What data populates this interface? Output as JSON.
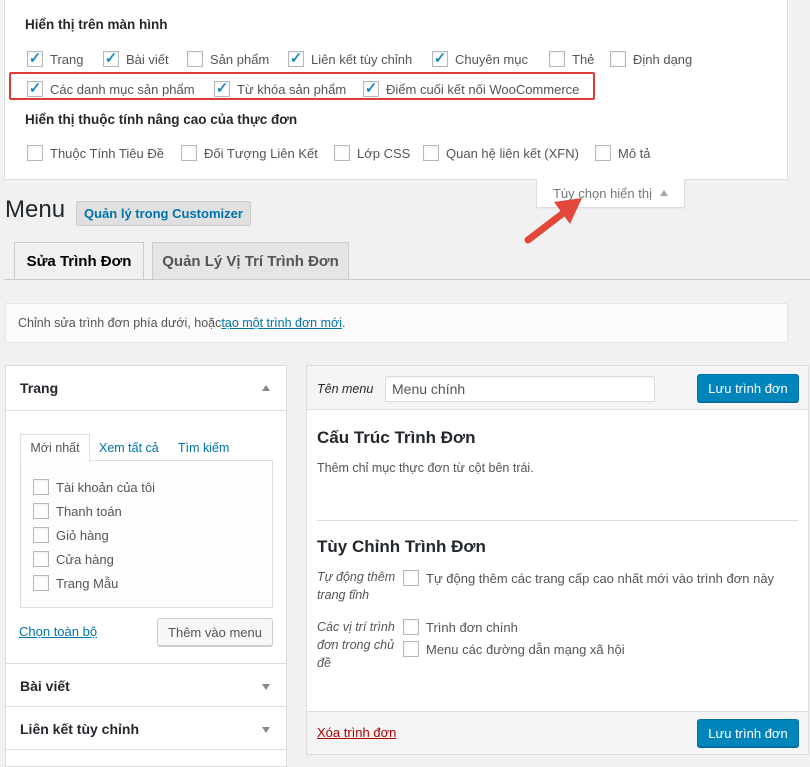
{
  "screen_options": {
    "heading_show": "Hiển thị trên màn hình",
    "boxes_row1": [
      {
        "label": "Trang",
        "checked": true
      },
      {
        "label": "Bài viết",
        "checked": true
      },
      {
        "label": "Sản phẩm",
        "checked": false
      },
      {
        "label": "Liên kết tùy chỉnh",
        "checked": true
      },
      {
        "label": "Chuyên mục",
        "checked": true
      },
      {
        "label": "Thẻ",
        "checked": false
      },
      {
        "label": "Định dạng",
        "checked": false
      }
    ],
    "boxes_row2": [
      {
        "label": "Các danh mục sản phẩm",
        "checked": true
      },
      {
        "label": "Từ khóa sản phẩm",
        "checked": true
      },
      {
        "label": "Điểm cuối kết nối WooCommerce",
        "checked": true
      }
    ],
    "heading_advanced": "Hiển thị thuộc tính nâng cao của thực đơn",
    "boxes_row3": [
      {
        "label": "Thuộc Tính Tiêu Đề",
        "checked": false
      },
      {
        "label": "Đối Tượng Liên Kết",
        "checked": false
      },
      {
        "label": "Lớp CSS",
        "checked": false
      },
      {
        "label": "Quan hệ liên kết (XFN)",
        "checked": false
      },
      {
        "label": "Mô tả",
        "checked": false
      }
    ],
    "toggle_label": "Tùy chọn hiển thị"
  },
  "page": {
    "title": "Menu",
    "customizer_button": "Quản lý trong Customizer"
  },
  "tabs": {
    "edit": "Sửa Trình Đơn",
    "locations": "Quản Lý Vị Trí Trình Đơn"
  },
  "manage_bar": {
    "text": "Chỉnh sửa trình đơn phía dưới, hoặc ",
    "link": "tạo một trình đơn mới",
    "suffix": "."
  },
  "left_panel": {
    "pages_title": "Trang",
    "sub_tabs": [
      "Mới nhất",
      "Xem tất cả",
      "Tìm kiếm"
    ],
    "pages": [
      "Tài khoản của tôi",
      "Thanh toán",
      "Giỏ hàng",
      "Cửa hàng",
      "Trang Mẫu"
    ],
    "select_all": "Chọn toàn bộ",
    "add_to_menu": "Thêm vào menu",
    "sections": [
      "Bài viết",
      "Liên kết tùy chỉnh"
    ]
  },
  "right_panel": {
    "menu_name_label": "Tên menu",
    "menu_name_value": "Menu chính",
    "save_label": "Lưu trình đơn",
    "structure_title": "Cấu Trúc Trình Đơn",
    "structure_desc": "Thêm chỉ mục thực đơn từ cột bên trái.",
    "settings_title": "Tùy Chỉnh Trình Đơn",
    "auto_add_label": "Tự động thêm trang tĩnh",
    "auto_add_option": "Tự động thêm các trang cấp cao nhất mới vào trình đơn này",
    "locations_label": "Các vị trí trình đơn trong chủ đề",
    "locations_options": [
      "Trình đơn chính",
      "Menu các đường dẫn mạng xã hội"
    ],
    "delete_label": "Xóa trình đơn"
  },
  "colors": {
    "accent": "#0073aa",
    "primary_button": "#0085ba",
    "highlight": "#dd3d36",
    "arrow": "#e2473a"
  }
}
